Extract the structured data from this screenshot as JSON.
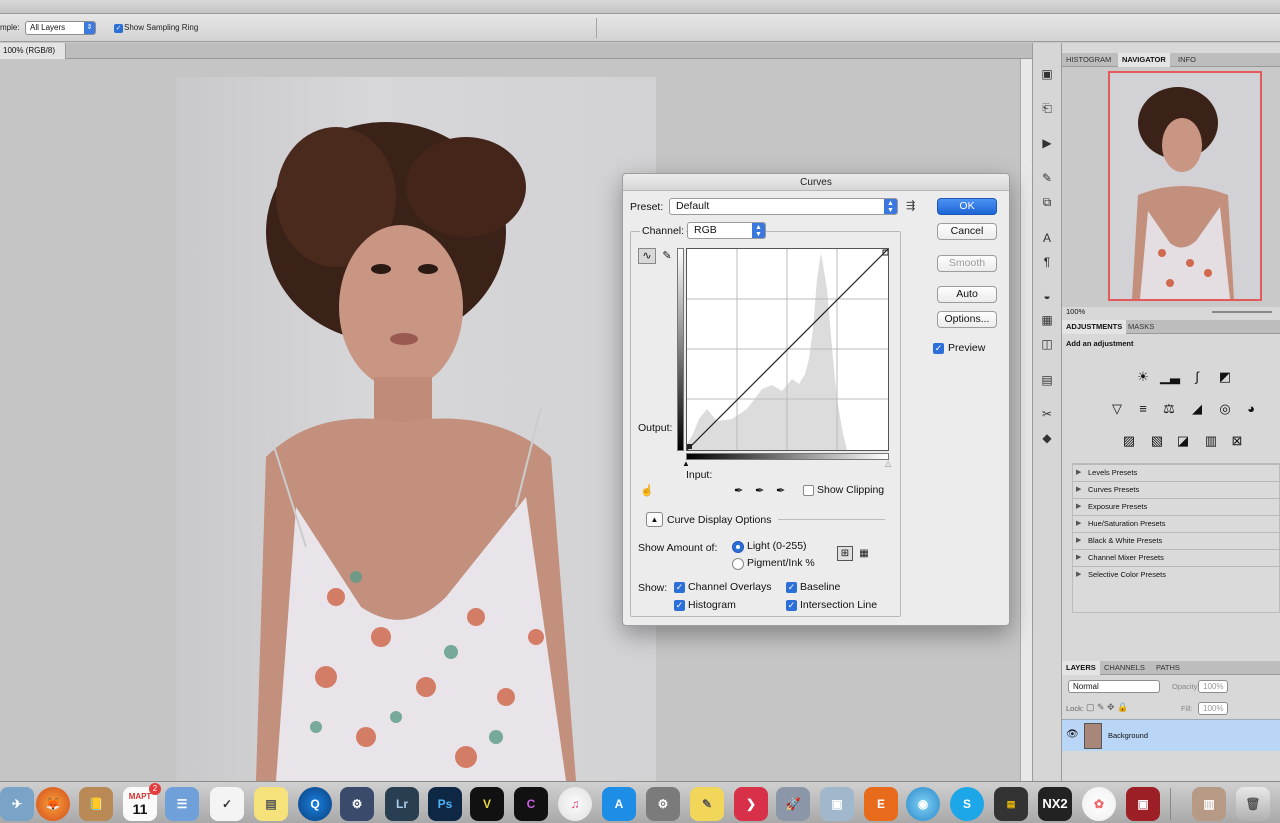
{
  "options_bar": {
    "sample_label": "mple:",
    "sample_value": "All Layers",
    "sampling_ring_label": "Show Sampling Ring"
  },
  "document": {
    "tab_label": "100% (RGB/8)"
  },
  "curves": {
    "title": "Curves",
    "preset_label": "Preset:",
    "preset_value": "Default",
    "channel_label": "Channel:",
    "channel_value": "RGB",
    "output_label": "Output:",
    "input_label": "Input:",
    "show_clipping": "Show Clipping",
    "curve_display_options": "Curve Display Options",
    "show_amount_label": "Show Amount of:",
    "light_label": "Light  (0-255)",
    "pigment_label": "Pigment/Ink %",
    "show_label": "Show:",
    "channel_overlays": "Channel Overlays",
    "baseline": "Baseline",
    "histogram": "Histogram",
    "intersection_line": "Intersection Line",
    "buttons": {
      "ok": "OK",
      "cancel": "Cancel",
      "smooth": "Smooth",
      "auto": "Auto",
      "options": "Options..."
    },
    "preview_label": "Preview"
  },
  "navigator": {
    "tabs": [
      "HISTOGRAM",
      "NAVIGATOR",
      "INFO"
    ],
    "zoom": "100%"
  },
  "adjustments": {
    "tabs": [
      "ADJUSTMENTS",
      "MASKS"
    ],
    "heading": "Add an adjustment",
    "presets": [
      "Levels Presets",
      "Curves Presets",
      "Exposure Presets",
      "Hue/Saturation Presets",
      "Black & White Presets",
      "Channel Mixer Presets",
      "Selective Color Presets"
    ]
  },
  "layers": {
    "tabs": [
      "LAYERS",
      "CHANNELS",
      "PATHS"
    ],
    "blend_mode": "Normal",
    "opacity_label": "Opacity:",
    "opacity_value": "100%",
    "lock_label": "Lock:",
    "fill_label": "Fill:",
    "fill_value": "100%",
    "layer_name": "Background"
  },
  "dock": {
    "calendar_month": "МАРТ",
    "calendar_day": "11",
    "calendar_badge": "2",
    "lr": "Lr",
    "ps": "Ps",
    "nx": "NX2"
  }
}
